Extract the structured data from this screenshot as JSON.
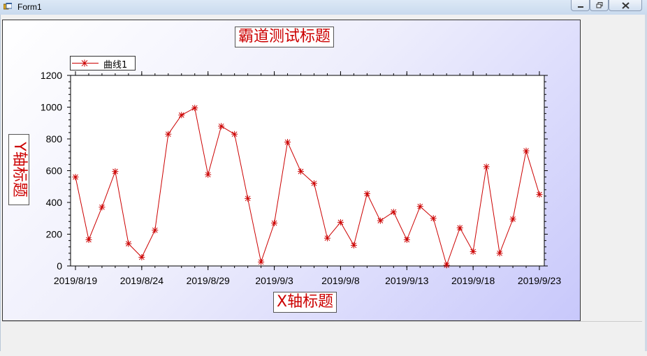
{
  "window": {
    "title": "Form1"
  },
  "chart_data": {
    "type": "line",
    "title": "霸道测试标题",
    "xlabel": "X轴标题",
    "ylabel": "Y轴标题",
    "x_tick_labels": [
      "2019/8/19",
      "2019/8/24",
      "2019/8/29",
      "2019/9/3",
      "2019/9/8",
      "2019/9/13",
      "2019/9/18",
      "2019/9/23"
    ],
    "y_ticks": [
      0,
      200,
      400,
      600,
      800,
      1000,
      1200
    ],
    "ylim": [
      0,
      1200
    ],
    "xlim": [
      "2019/8/19",
      "2019/9/23"
    ],
    "legend": {
      "position": "top-left",
      "entries": [
        "曲线1"
      ]
    },
    "grid": false,
    "colors": {
      "series": "#cc0000",
      "title_text": "#cc0000"
    },
    "series": [
      {
        "name": "曲线1",
        "x": [
          "2019/8/19",
          "2019/8/20",
          "2019/8/21",
          "2019/8/22",
          "2019/8/23",
          "2019/8/24",
          "2019/8/25",
          "2019/8/26",
          "2019/8/27",
          "2019/8/28",
          "2019/8/29",
          "2019/8/30",
          "2019/8/31",
          "2019/9/1",
          "2019/9/2",
          "2019/9/3",
          "2019/9/4",
          "2019/9/5",
          "2019/9/6",
          "2019/9/7",
          "2019/9/8",
          "2019/9/9",
          "2019/9/10",
          "2019/9/11",
          "2019/9/12",
          "2019/9/13",
          "2019/9/14",
          "2019/9/15",
          "2019/9/16",
          "2019/9/17",
          "2019/9/18",
          "2019/9/19",
          "2019/9/20",
          "2019/9/21",
          "2019/9/22",
          "2019/9/23"
        ],
        "values": [
          560,
          165,
          370,
          595,
          140,
          55,
          225,
          830,
          950,
          995,
          575,
          880,
          830,
          425,
          25,
          270,
          780,
          595,
          520,
          175,
          275,
          130,
          455,
          285,
          340,
          165,
          375,
          300,
          5,
          240,
          90,
          625,
          80,
          295,
          725,
          450
        ]
      }
    ]
  }
}
